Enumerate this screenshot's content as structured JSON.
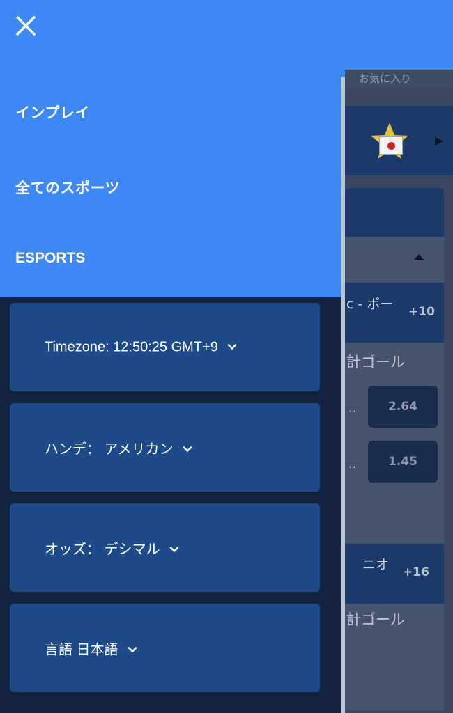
{
  "drawer": {
    "close_icon": "close-icon",
    "nav": [
      {
        "label": "インプレイ"
      },
      {
        "label": "全てのスポーツ"
      },
      {
        "label": "ESPORTS"
      }
    ],
    "settings": [
      {
        "label": "Timezone: 12:50:25 GMT+9"
      },
      {
        "label": "ハンデ： アメリカン"
      },
      {
        "label": "オッズ： デシマル"
      },
      {
        "label": "言語 日本語"
      }
    ]
  },
  "background": {
    "favorites_tab": "お気に入り",
    "rows": [
      {
        "title": "c - ポー",
        "count": "+10",
        "market": "計ゴール"
      },
      {
        "title": "ニオ",
        "count": "+16",
        "market": "計ゴール"
      }
    ],
    "odds": [
      "2.64",
      "1.45"
    ],
    "ellipsis": ".."
  },
  "colors": {
    "drawer_blue": "#3e88f6",
    "drawer_dark": "#13223f",
    "card_blue": "#1f4a8a"
  }
}
